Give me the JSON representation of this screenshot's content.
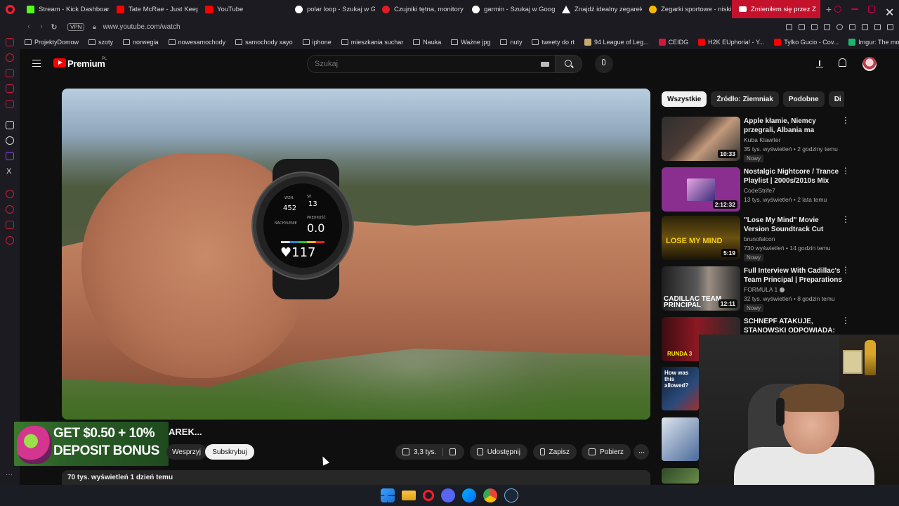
{
  "browser": {
    "tabs": [
      {
        "label": "Stream - Kick Dashboard",
        "color": "#53fc18"
      },
      {
        "label": "Tate McRae - Just Keep",
        "color": "#ff0000"
      },
      {
        "label": "YouTube",
        "color": "#ff0000"
      },
      {
        "label": "polar loop - Szukaj w Go",
        "color": "#ffffff"
      },
      {
        "label": "Czujniki tętna, monitory",
        "color": "#e31c23"
      },
      {
        "label": "garmin - Szukaj w Goog",
        "color": "#ffffff"
      },
      {
        "label": "Znajdź idealny zegarek",
        "color": "#ffffff"
      },
      {
        "label": "Zegarki sportowe - niski",
        "color": "#f5b800"
      },
      {
        "label": "Zmieniłem się przez Z",
        "color": "#ffffff",
        "active": true
      }
    ],
    "vpn_label": "VPN",
    "url": "www.youtube.com/watch",
    "bookmarks": [
      {
        "label": "ProjektyDomow",
        "kind": "folder"
      },
      {
        "label": "szoty",
        "kind": "folder"
      },
      {
        "label": "norwegia",
        "kind": "folder"
      },
      {
        "label": "nowesamochody",
        "kind": "folder"
      },
      {
        "label": "samochody xayo",
        "kind": "folder"
      },
      {
        "label": "iphone",
        "kind": "folder"
      },
      {
        "label": "mieszkania suchar",
        "kind": "folder"
      },
      {
        "label": "Nauka",
        "kind": "folder"
      },
      {
        "label": "Ważne jpg",
        "kind": "folder"
      },
      {
        "label": "nuty",
        "kind": "folder"
      },
      {
        "label": "tweety do rt",
        "kind": "folder"
      },
      {
        "label": "94 League of Leg...",
        "kind": "site",
        "color": "#c8aa6e"
      },
      {
        "label": "CEIDG",
        "kind": "site",
        "color": "#dc143c"
      },
      {
        "label": "H2K EUphoria! - Y...",
        "kind": "site",
        "color": "#ff0000"
      },
      {
        "label": "Tylko Gucio - Cov...",
        "kind": "site",
        "color": "#ff0000"
      },
      {
        "label": "Imgur: The most a...",
        "kind": "site",
        "color": "#1bb76e"
      }
    ]
  },
  "youtube": {
    "brand": "Premium",
    "brand_region": "PL",
    "search_placeholder": "Szukaj",
    "video": {
      "title_fragment": "AREK...",
      "support_label": "Wesprzyj",
      "subscribe_label": "Subskrybuj",
      "likes": "3,3 tys.",
      "share_label": "Udostępnij",
      "save_label": "Zapisz",
      "download_label": "Pobierz",
      "views_date": "70 tys. wyświetleń  1 dzień temu"
    },
    "watch_screen": {
      "wzn_label": "WZN.",
      "wzn_value": "452",
      "sp_label": "SP.",
      "sp_value": "13",
      "nachylenie_label": "NACHYLENIE",
      "predkosc_label": "PRĘDKOŚĆ",
      "predkosc_value": "0.0",
      "hr_value": "♥117"
    },
    "ad": {
      "line1": "GET $0.50 + 10%",
      "line2": "DEPOSIT BONUS"
    },
    "chips": [
      "Wszystkie",
      "Źródło: Ziemniak",
      "Podobne",
      "Di"
    ],
    "recommendations": [
      {
        "title": "Apple kłamie, Niemcy przegrali, Albania ma ministra AI | Tech ...",
        "channel": "Kuba Klawiter",
        "meta": "35 tys. wyświetleń • 2 godziny temu",
        "badge": "Nowy",
        "duration": "10:33"
      },
      {
        "title": "Nostalgic Nightcore / Trance Playlist | 2000s/2010s Mix",
        "channel": "CodeStrife7",
        "meta": "13 tys. wyświetleń • 2 lata temu",
        "badge": "",
        "duration": "2:12:32"
      },
      {
        "title": "\"Lose My Mind\" Movie Version Soundtrack Cut (Extended)",
        "channel": "brunofalcon",
        "meta": "730 wyświetleń • 14 godzin temu",
        "badge": "Nowy",
        "duration": "5:19",
        "thumb_text": "LOSE MY MIND"
      },
      {
        "title": "Full Interview With Cadillac's Team Principal | Preparations ...",
        "channel": "FORMULA 1",
        "meta": "32 tys. wyświetleń • 8 godzin temu",
        "badge": "Nowy",
        "duration": "12:11",
        "thumb_text": "CADILLAC TEAM PRINCIPAL"
      },
      {
        "title": "SCHNEPF ATAKUJE, STANOWSKI ODPOWIADA: ...",
        "channel": "",
        "meta": "",
        "badge": "",
        "duration": "",
        "thumb_text": "RUNDA 3"
      }
    ],
    "side_thumb_text": "How was this allowed?"
  }
}
